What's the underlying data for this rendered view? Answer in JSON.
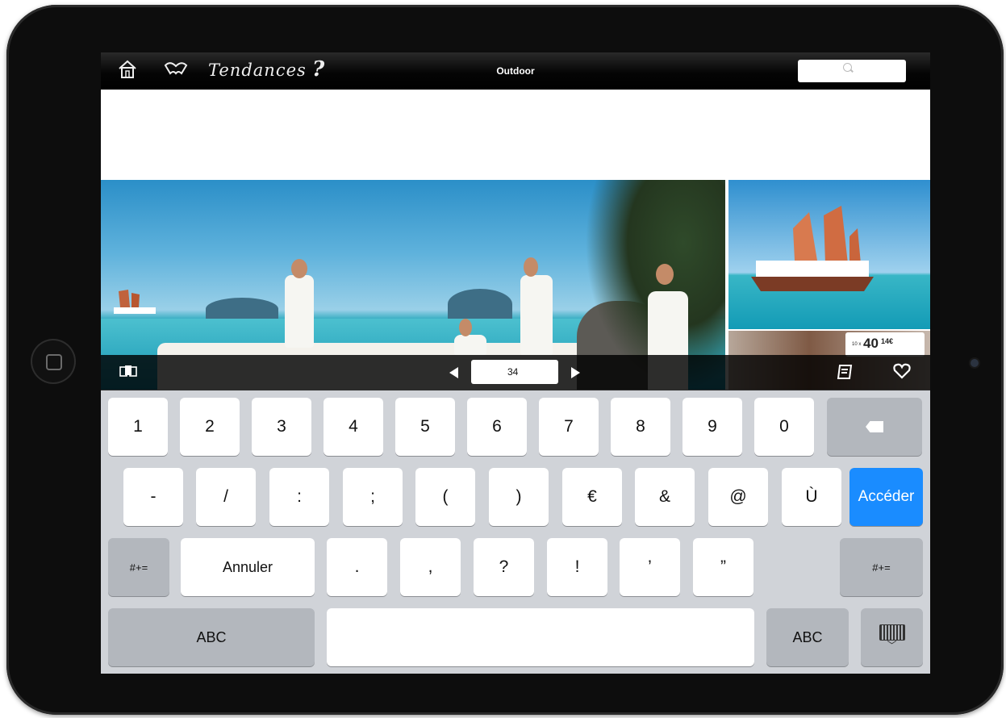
{
  "topbar": {
    "home_icon": "house-icon",
    "book_icon": "open-book-icon",
    "brand": "Tendances",
    "help": "?",
    "title": "Outdoor",
    "search_placeholder": ""
  },
  "photos": {
    "side_price": "40",
    "side_price_cents": "14€"
  },
  "navbar": {
    "page_value": "34",
    "thumbs_icon": "pages-icon",
    "notes_icon": "edit-icon",
    "favorite_icon": "heart-icon"
  },
  "keyboard": {
    "row1": [
      "1",
      "2",
      "3",
      "4",
      "5",
      "6",
      "7",
      "8",
      "9",
      "0"
    ],
    "row2": [
      "-",
      "/",
      ":",
      ";",
      "(",
      ")",
      "€",
      "&",
      "@",
      "Ù"
    ],
    "go": "Accéder",
    "symbols_left": "#+=",
    "cancel": "Annuler",
    "row3": [
      ".",
      ",",
      "?",
      "!",
      "’",
      "”"
    ],
    "symbols_right": "#+=",
    "abc_left": "ABC",
    "abc_right": "ABC"
  },
  "colors": {
    "accent": "#1a8cff",
    "keyboard_bg": "#d0d3d8"
  }
}
